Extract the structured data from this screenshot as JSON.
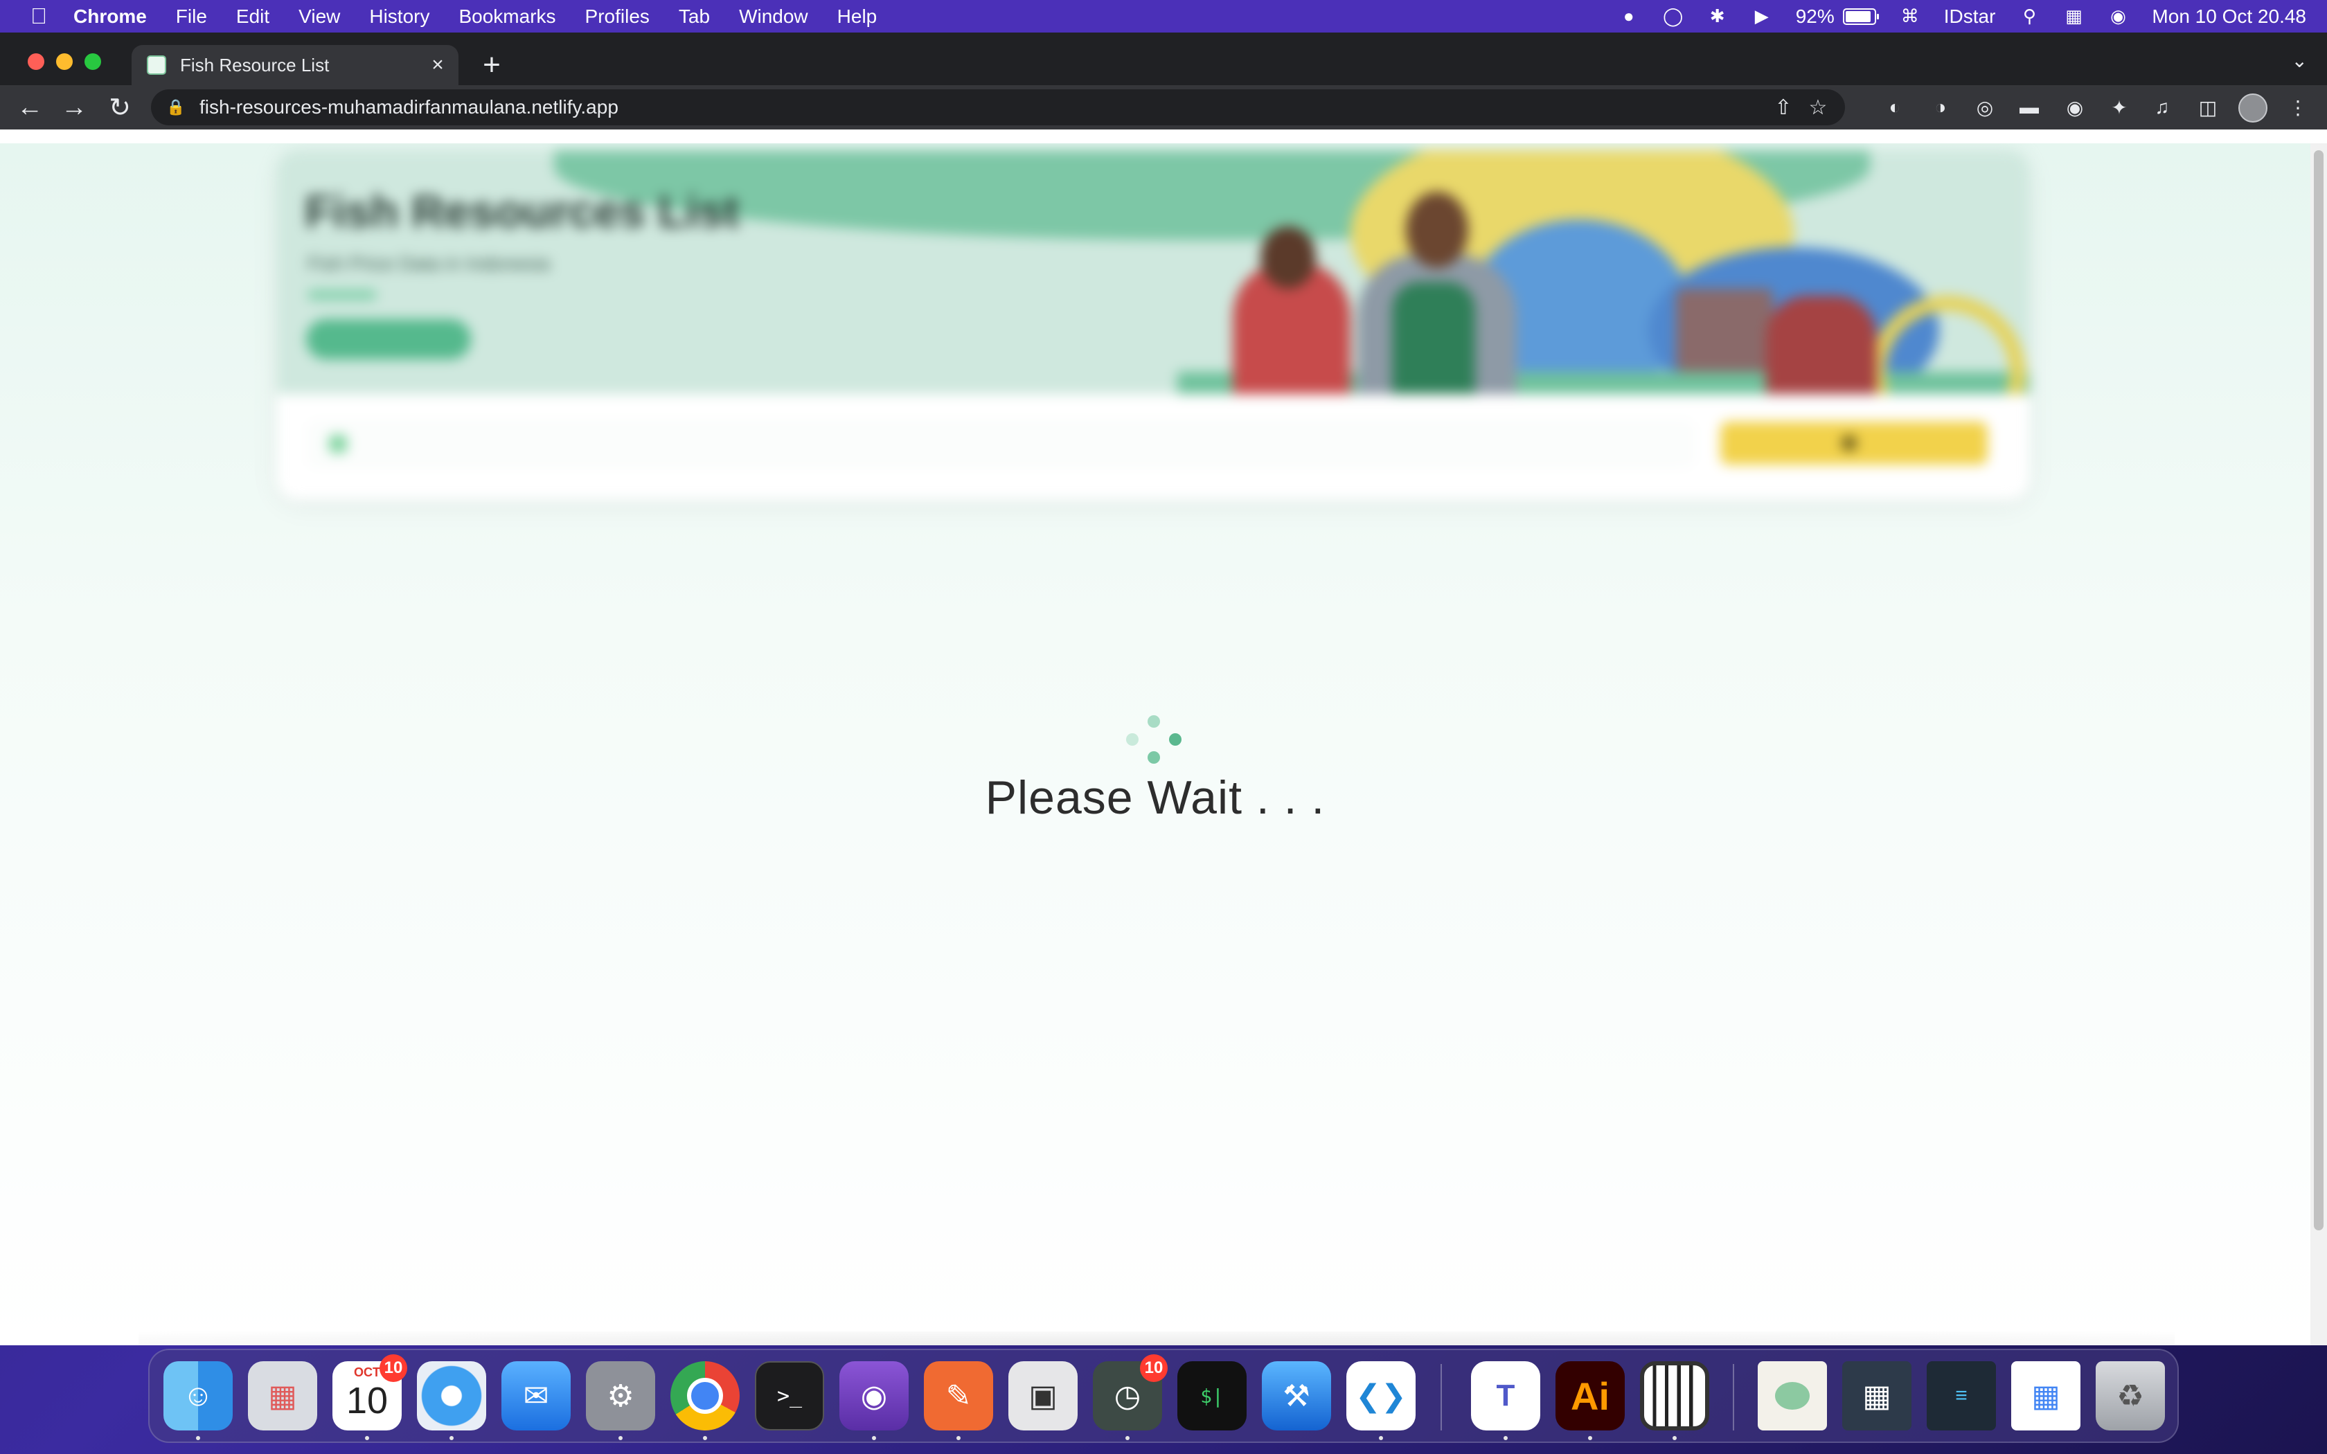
{
  "menubar": {
    "app_name": "Chrome",
    "menus": [
      "File",
      "Edit",
      "View",
      "History",
      "Bookmarks",
      "Profiles",
      "Tab",
      "Window",
      "Help"
    ],
    "battery_percent": "92%",
    "battery_level": 0.92,
    "user": "IDstar",
    "datetime": "Mon 10 Oct  20.48"
  },
  "browser": {
    "tab_title": "Fish Resource List",
    "url": "fish-resources-muhamadirfanmaulana.netlify.app",
    "traffic_colors": [
      "#ff5f57",
      "#febc2e",
      "#28c840"
    ]
  },
  "page": {
    "hero_title": "Fish Resources List",
    "hero_subtitle": "Fish Price Data in Indonesia",
    "loading_text": "Please Wait . . .",
    "accent_color": "#55b98d",
    "search_button_color": "#f2d24b"
  },
  "dock": {
    "calendar_month": "OCT",
    "calendar_day": "10",
    "calendar_badge": "10",
    "activity_badge": "10",
    "illustrator_label": "Ai"
  }
}
